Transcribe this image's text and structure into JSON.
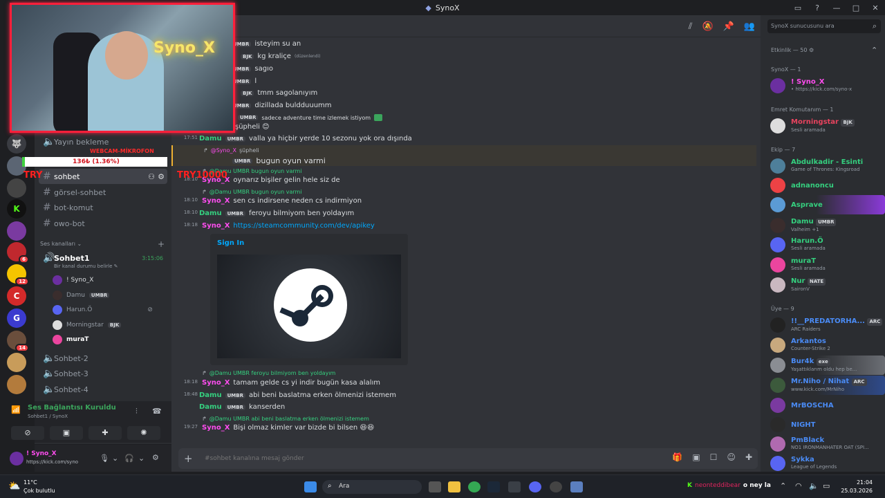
{
  "window": {
    "title": "SynoX"
  },
  "search": {
    "placeholder": "SynoX sunucusunu ara"
  },
  "overlay": {
    "webcam_label": "WEBCAM-MİKROFON",
    "meter_text": "136₺ (1.36%)",
    "try_left": "TRY",
    "try_right": "TRY10000",
    "neon": "Syno_X"
  },
  "guild_badges": [
    "6",
    "12",
    "14"
  ],
  "channels": {
    "items": [
      {
        "name": "Yayın bekleme",
        "kind": "voice"
      },
      {
        "name": "sohbet",
        "kind": "text"
      },
      {
        "name": "görsel-sohbet",
        "kind": "text"
      },
      {
        "name": "bot-komut",
        "kind": "text"
      },
      {
        "name": "owo-bot",
        "kind": "text"
      }
    ],
    "voice_category": "Ses kanalları",
    "voice_channel": "Sohbet1",
    "voice_timer": "3:15:06",
    "voice_status": "Bir kanal durumu belirle",
    "voice_users": [
      {
        "name": "! Syno_X",
        "tag": ""
      },
      {
        "name": "Damu",
        "tag": "UMBR"
      },
      {
        "name": "Harun.Ö",
        "tag": ""
      },
      {
        "name": "Morningstar",
        "tag": "BJK"
      },
      {
        "name": "muraT",
        "tag": ""
      }
    ],
    "other_voice": [
      "Sohbet-2",
      "Sohbet-3",
      "Sohbet-4"
    ]
  },
  "voice_connection": {
    "status": "Ses Bağlantısı Kuruldu",
    "location": "Sohbet1 / SynoX"
  },
  "user": {
    "name": "! Syno_X",
    "status": "https://kick.com/syno"
  },
  "messages": [
    {
      "time": "",
      "name": "",
      "tag": "UMBR",
      "text": "isteyim su an"
    },
    {
      "time": "",
      "name": "",
      "tag": "BJK",
      "text": "kg kraliçe",
      "edited": "(düzenlendi)"
    },
    {
      "time": "",
      "name": "",
      "tag": "UMBR",
      "text": "sagıo"
    },
    {
      "time": "",
      "name": "",
      "tag": "UMBR",
      "text": "l"
    },
    {
      "time": "",
      "name": "",
      "tag": "BJK",
      "text": "tmm sagolanıyım"
    },
    {
      "time": "",
      "name": "",
      "tag": "UMBR",
      "text": "dizillada buldduuumm"
    },
    {
      "time": "",
      "name": "",
      "tag": "UMBR",
      "text": "sadece adventure time izlemek istiyom"
    },
    {
      "time": "",
      "name": "",
      "tag": "",
      "text": "şüpheli 😊"
    },
    {
      "time": "17:51",
      "name": "Damu",
      "tag": "UMBR",
      "text": "valla ya hiçbir yerde 10 sezonu yok ora dışında"
    },
    {
      "time": "",
      "name": "",
      "tag": "UMBR",
      "text": "bugun oyun varmi",
      "reply": "şüpheli"
    },
    {
      "time": "18:10",
      "name": "Syno_X",
      "tag": "",
      "text": "oynarız bişiler gelin hele siz de",
      "reply": "@Damu UMBR bugun oyun varmi"
    },
    {
      "time": "18:10",
      "name": "Syno_X",
      "tag": "",
      "text": "sen cs indirsene neden cs indirmiyon",
      "reply": "@Damu UMBR bugun oyun varmi"
    },
    {
      "time": "18:10",
      "name": "Damu",
      "tag": "UMBR",
      "text": "feroyu bilmiyom ben yoldayım"
    },
    {
      "time": "18:18",
      "name": "Syno_X",
      "tag": "",
      "text": "https://steamcommunity.com/dev/apikey"
    },
    {
      "time": "18:18",
      "name": "Syno_X",
      "tag": "",
      "text": "tamam gelde cs yi indir bugün kasa alalım",
      "reply": "@Damu UMBR feroyu bilmiyom ben yoldayım"
    },
    {
      "time": "18:48",
      "name": "Damu",
      "tag": "UMBR",
      "text": "abi beni baslatma erken ölmenizi istemem"
    },
    {
      "time": "",
      "name": "Damu",
      "tag": "UMBR",
      "text": "kanserden"
    },
    {
      "time": "19:27",
      "name": "Syno_X",
      "tag": "",
      "text": "Bişi olmaz kimler var bizde bi bilsen 😆😆",
      "reply": "@Damu UMBR abi beni baslatma erken ölmenizi istemem"
    }
  ],
  "embed": {
    "title": "Sign In"
  },
  "composer": {
    "placeholder": "#sohbet kanalına mesaj gönder"
  },
  "members": {
    "activity": "Etkinlik — 50",
    "groups": [
      {
        "title": "SynoX — 1",
        "members": [
          {
            "name": "! Syno_X",
            "status": "• https://kick.com/syno-x",
            "color": "#ff4df0"
          }
        ]
      },
      {
        "title": "Emret Komutanım — 1",
        "members": [
          {
            "name": "Morningstar",
            "status": "Sesli aramada",
            "color": "#e9435e",
            "tag": "BJK"
          }
        ]
      },
      {
        "title": "Ekip — 7",
        "members": [
          {
            "name": "Abdulkadir - Esinti",
            "status": "Game of Thrones: Kingsroad",
            "color": "#35d07f"
          },
          {
            "name": "adnanoncu",
            "status": "",
            "color": "#35d07f"
          },
          {
            "name": "Asprave",
            "status": "",
            "color": "#35d07f"
          },
          {
            "name": "Damu",
            "status": "Valheim +1",
            "color": "#35d07f",
            "tag": "UMBR"
          },
          {
            "name": "Harun.Ö",
            "status": "Sesli aramada",
            "color": "#35d07f"
          },
          {
            "name": "muraT",
            "status": "Sesli aramada",
            "color": "#35d07f"
          },
          {
            "name": "Nur",
            "status": "SaironV",
            "color": "#35d07f",
            "tag": "NATE"
          }
        ]
      },
      {
        "title": "Üye — 9",
        "members": [
          {
            "name": "!!__PREDATORHA...",
            "status": "ARC Raiders",
            "color": "#4a8bf5",
            "tag": "ARC"
          },
          {
            "name": "Arkantos",
            "status": "Counter-Strike 2",
            "color": "#4a8bf5"
          },
          {
            "name": "Bur4k",
            "status": "Yaşattıklarım oldu hep be...",
            "color": "#4a8bf5",
            "tag": "exe"
          },
          {
            "name": "Mr.Niho / Nihat",
            "status": "www.kick.com/MrNiho",
            "color": "#4a8bf5",
            "tag": "ARC"
          },
          {
            "name": "MrBOSCHA",
            "status": "",
            "color": "#4a8bf5"
          },
          {
            "name": "NIGHT",
            "status": "",
            "color": "#4a8bf5"
          },
          {
            "name": "PmBlack",
            "status": "NO1 IRONMANHATER OAT (SPI...",
            "color": "#4a8bf5"
          },
          {
            "name": "Sykka",
            "status": "League of Legends",
            "color": "#4a8bf5"
          }
        ]
      }
    ]
  },
  "taskbar": {
    "weather_temp": "11°C",
    "weather_desc": "Çok bulutlu",
    "search": "Ara",
    "ticker_user": "neonteddibear",
    "ticker_text": "o ney la",
    "time": "21:04",
    "date": "25.03.2026"
  },
  "colors": {
    "accent": "#5865f2",
    "synox": "#ff4df0",
    "damu": "#35d07f",
    "webcam_border": "#ff1f3a"
  }
}
